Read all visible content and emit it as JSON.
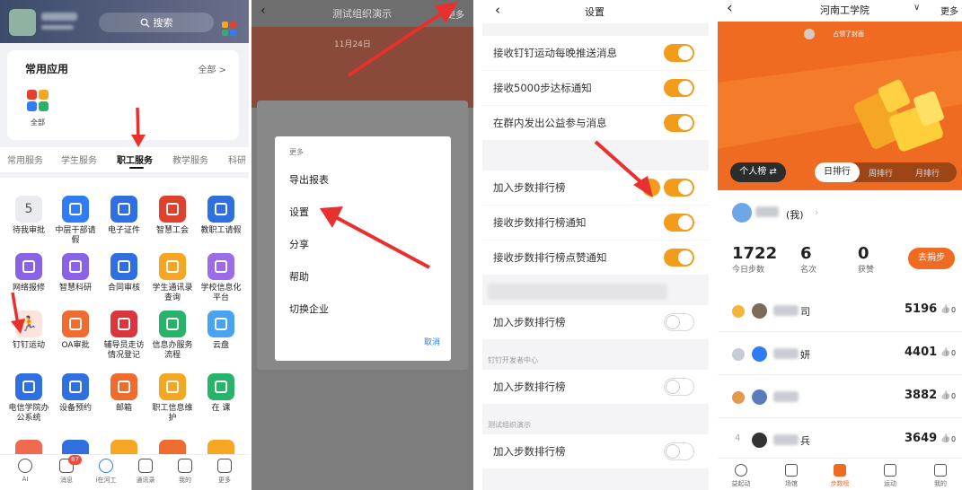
{
  "panel1": {
    "search_label": "搜索",
    "common_apps_title": "常用应用",
    "all_link": "全部 >",
    "all_icon_label": "全部",
    "tabs": [
      "常用服务",
      "学生服务",
      "职工服务",
      "教学服务",
      "科研"
    ],
    "active_tab": "职工服务",
    "grid": [
      {
        "label": "待我审批",
        "icon": "five-badge-icon",
        "color": "#e9ebef"
      },
      {
        "label": "中层干部请假",
        "icon": "document-icon",
        "color": "#2f7cf6"
      },
      {
        "label": "电子证件",
        "icon": "id-card-icon",
        "color": "#2f6fe0"
      },
      {
        "label": "智慧工会",
        "icon": "union-emblem-icon",
        "color": "#e0412c"
      },
      {
        "label": "教职工请假",
        "icon": "person-clock-icon",
        "color": "#2f6fe0"
      },
      {
        "label": "网络报修",
        "icon": "wrench-house-icon",
        "color": "#8a62e6"
      },
      {
        "label": "智慧科研",
        "icon": "org-chart-icon",
        "color": "#8a62e6"
      },
      {
        "label": "合同审核",
        "icon": "contract-icon",
        "color": "#2f6fe0"
      },
      {
        "label": "学生通讯录查询",
        "icon": "magnifier-icon",
        "color": "#f5a623"
      },
      {
        "label": "学校信息化平台",
        "icon": "qa-icon",
        "color": "#9c6be8"
      },
      {
        "label": "钉钉运动",
        "icon": "runner-icon",
        "color": "#fde3dc"
      },
      {
        "label": "OA审批",
        "icon": "stamp-icon",
        "color": "#f06b2e"
      },
      {
        "label": "辅导员走访情况登记",
        "icon": "book-icon",
        "color": "#d9363e"
      },
      {
        "label": "信息办服务流程",
        "icon": "tools-icon",
        "color": "#27b36a"
      },
      {
        "label": "云盘",
        "icon": "cloud-icon",
        "color": "#4aa3f0"
      },
      {
        "label": "电信学院办公系统",
        "icon": "college-seal-icon",
        "color": "#2f6fe0"
      },
      {
        "label": "设备预约",
        "icon": "calendar-clock-icon",
        "color": "#2f6fe0"
      },
      {
        "label": "邮箱",
        "icon": "mail-icon",
        "color": "#f06b2e"
      },
      {
        "label": "职工信息维护",
        "icon": "card-icon",
        "color": "#f5a623"
      },
      {
        "label": "在 课",
        "icon": "camera-icon",
        "color": "#27b36a"
      }
    ],
    "bottom_nav": [
      {
        "label": "AI",
        "icon": "ai-icon"
      },
      {
        "label": "消息",
        "icon": "message-icon",
        "badge": "87"
      },
      {
        "label": "i在河工",
        "icon": "home-icon"
      },
      {
        "label": "通讯录",
        "icon": "contacts-icon"
      },
      {
        "label": "我的",
        "icon": "profile-icon"
      },
      {
        "label": "更多",
        "icon": "more-grid-icon"
      }
    ]
  },
  "panel2": {
    "title": "测试组织演示",
    "more": "更多",
    "date_text": "11月24日",
    "menu_header": "更多",
    "menu_items": [
      "导出报表",
      "设置",
      "分享",
      "帮助",
      "切换企业"
    ],
    "cancel": "取消"
  },
  "panel3": {
    "title": "设置",
    "rows_top": [
      {
        "label": "接收钉钉运动每晚推送消息",
        "on": true
      },
      {
        "label": "接收5000步达标通知",
        "on": true
      },
      {
        "label": "在群内发出公益参与消息",
        "on": true
      }
    ],
    "rows_mid": [
      {
        "label": "加入步数排行榜",
        "on": true
      },
      {
        "label": "接收步数排行榜通知",
        "on": true
      },
      {
        "label": "接收步数排行榜点赞通知",
        "on": true
      }
    ],
    "row_a": {
      "label": "加入步数排行榜",
      "on": false
    },
    "section_b": "钉钉开发者中心",
    "row_b": {
      "label": "加入步数排行榜",
      "on": false
    },
    "section_c": "测试组织演示",
    "row_c": {
      "label": "加入步数排行榜",
      "on": false
    }
  },
  "panel4": {
    "title": "河南工学院",
    "more": "更多",
    "cover_text": "占领了封面",
    "tab_personal": "个人榜 ⇄",
    "tab_daily": "日排行",
    "tab_weekly": "周排行",
    "tab_monthly": "月排行",
    "me_label": "(我)",
    "stats": [
      {
        "value": "1722",
        "label": "今日步数"
      },
      {
        "value": "6",
        "label": "名次"
      },
      {
        "value": "0",
        "label": "获赞"
      }
    ],
    "walk_button": "去捐步",
    "ranks": [
      {
        "name_tail": "司",
        "steps": "5196",
        "likes": "0",
        "rank_icon": "gold-medal-icon"
      },
      {
        "name_tail": "妍",
        "steps": "4401",
        "likes": "0",
        "rank_icon": "silver-medal-icon"
      },
      {
        "name_tail": "",
        "steps": "3882",
        "likes": "0",
        "rank_icon": "bronze-medal-icon"
      },
      {
        "name_tail": "兵",
        "steps": "3649",
        "likes": "0",
        "rank_icon": "4"
      }
    ],
    "bottom_nav": [
      {
        "label": "益起动",
        "icon": "charity-icon"
      },
      {
        "label": "场馆",
        "icon": "venue-icon"
      },
      {
        "label": "步数榜",
        "icon": "bar-chart-icon"
      },
      {
        "label": "运动",
        "icon": "pulse-icon"
      },
      {
        "label": "我的",
        "icon": "profile-icon"
      }
    ],
    "accent_color": "#f06b22"
  }
}
